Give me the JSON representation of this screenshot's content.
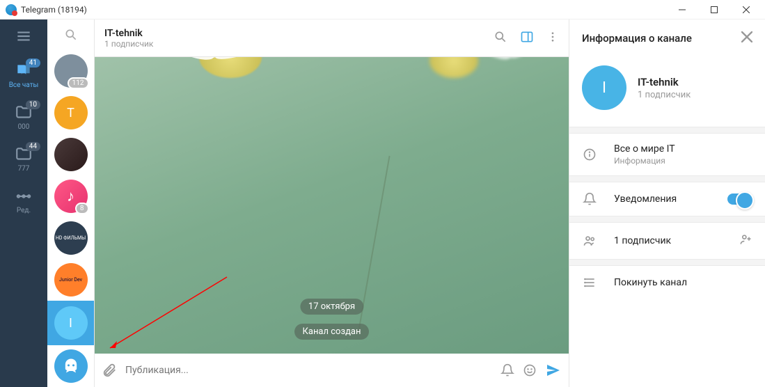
{
  "window": {
    "title": "Telegram (18194)"
  },
  "folders": {
    "all_chats": {
      "label": "Все чаты",
      "badge": "41"
    },
    "f000": {
      "label": "000",
      "badge": "10"
    },
    "f777": {
      "label": "777",
      "badge": "44"
    },
    "edit": {
      "label": "Ред."
    }
  },
  "chatlist": {
    "items": [
      {
        "letter": "",
        "badge": "112",
        "bg": "#7e8f9d"
      },
      {
        "letter": "T",
        "badge": "",
        "bg": "#f5a623"
      },
      {
        "letter": "",
        "badge": "",
        "bg": "#333",
        "img": "photo"
      },
      {
        "letter": "♪",
        "badge": "8",
        "bg": "#e94d8a"
      },
      {
        "letter": "",
        "badge": "",
        "bg": "#2d3e50",
        "label": "HD ФИЛЬМЫ"
      },
      {
        "letter": "",
        "badge": "",
        "bg": "#ff7f2a",
        "label": "Junior Dev"
      },
      {
        "letter": "I",
        "badge": "",
        "bg": "#5fc9f8",
        "selected": true
      },
      {
        "letter": "",
        "badge": "",
        "bg": "#40a7e3",
        "icon": "ghost"
      }
    ]
  },
  "chat": {
    "title": "IT-tehnik",
    "subtitle": "1 подписчик",
    "date_pill": "17 октября",
    "service_pill": "Канал создан",
    "composer_placeholder": "Публикация..."
  },
  "info": {
    "header": "Информация о канале",
    "name": "IT-tehnik",
    "subtitle": "1 подписчик",
    "avatar_letter": "I",
    "description": {
      "text": "Все о мире IT",
      "label": "Информация"
    },
    "notifications": "Уведомления",
    "subscribers": "1 подписчик",
    "leave": "Покинуть канал"
  }
}
